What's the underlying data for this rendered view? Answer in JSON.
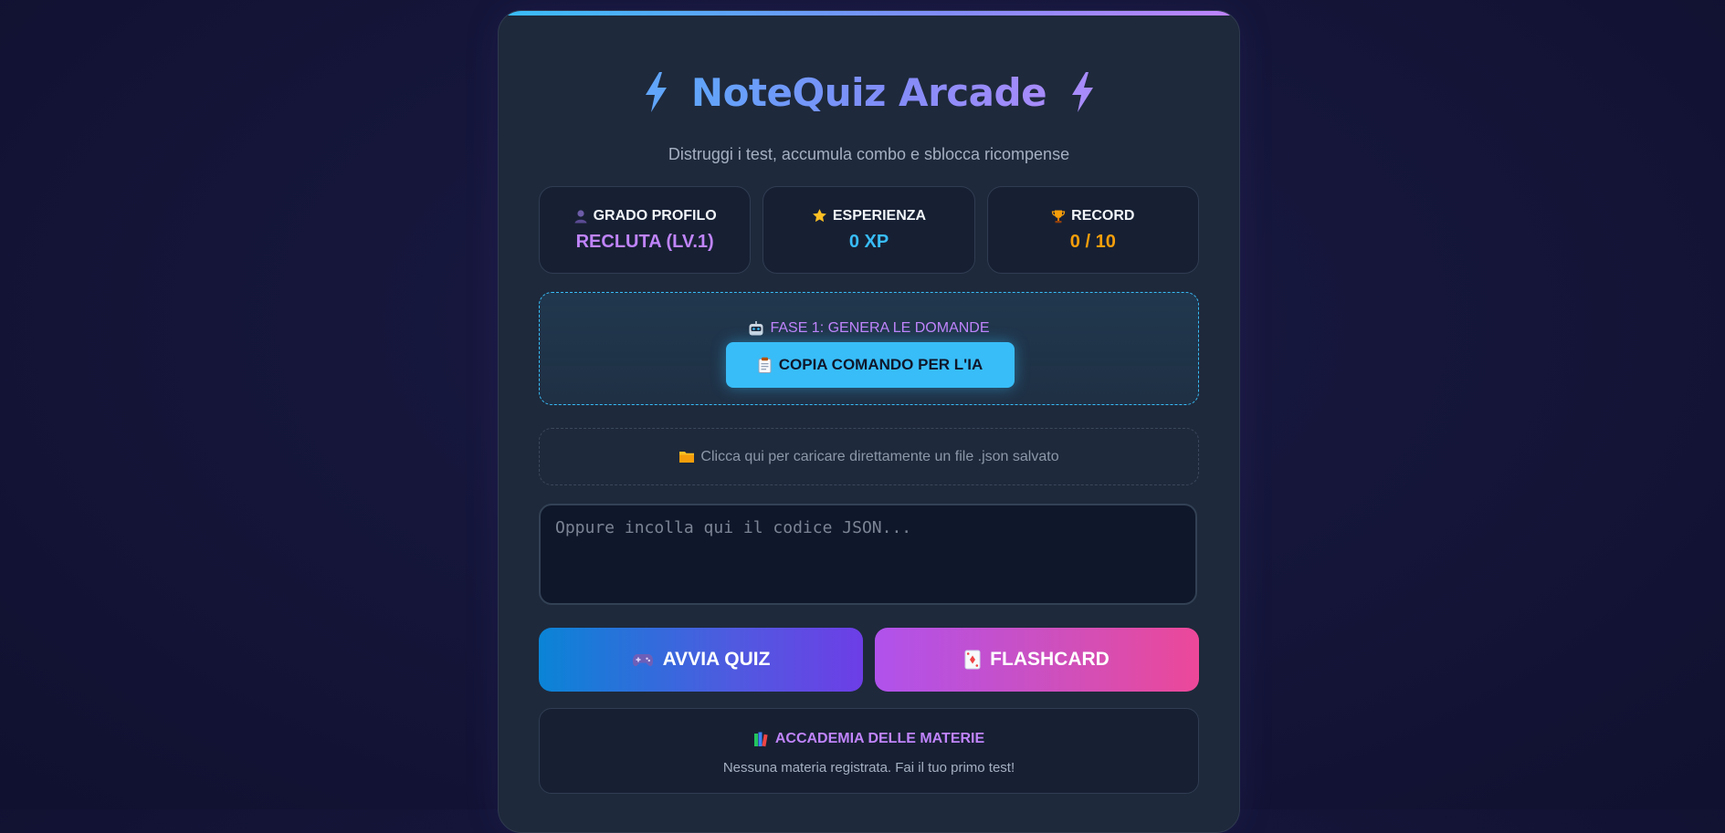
{
  "app": {
    "title": "NoteQuiz Arcade",
    "subtitle": "Distruggi i test, accumula combo e sblocca ricompense",
    "icons": [
      "lightning-icon",
      "lightning-icon"
    ]
  },
  "stats": [
    {
      "icon": "user-icon",
      "label": "GRADO PROFILO",
      "value": "RECLUTA (LV.1)",
      "color": "#c084fc"
    },
    {
      "icon": "star-icon",
      "label": "ESPERIENZA",
      "value": "0 XP",
      "color": "#38bdf8"
    },
    {
      "icon": "trophy-icon",
      "label": "RECORD",
      "value": "0 / 10",
      "color": "#f59e0b"
    }
  ],
  "phase1": {
    "icon": "robot-icon",
    "label": "FASE 1: GENERA LE DOMANDE",
    "button_icon": "clipboard-icon",
    "button_label": "COPIA COMANDO PER L'IA"
  },
  "upload": {
    "icon": "folder-icon",
    "label": "Clicca qui per caricare direttamente un file .json salvato"
  },
  "json_input": {
    "placeholder": "Oppure incolla qui il codice JSON...",
    "value": ""
  },
  "actions": {
    "quiz_icon": "gamepad-icon",
    "quiz_label": "AVVIA QUIZ",
    "flash_icon": "card-icon",
    "flash_label": "FLASHCARD"
  },
  "academy": {
    "icon": "books-icon",
    "title": "ACCADEMIA DELLE MATERIE",
    "empty_text": "Nessuna materia registrata. Fai il tuo primo test!"
  },
  "colors": {
    "accent_blue": "#38bdf8",
    "accent_purple": "#c084fc",
    "accent_orange": "#f59e0b",
    "card_bg": "#1e293b",
    "page_bg": "#15163a"
  }
}
